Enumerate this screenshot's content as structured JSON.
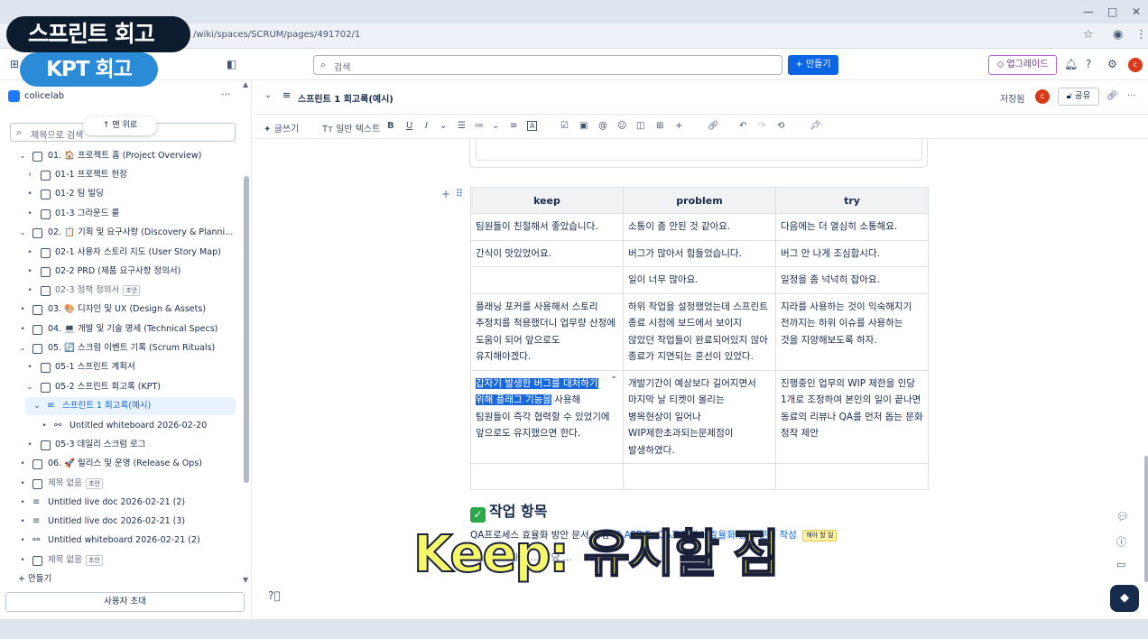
{
  "browser": {
    "url": "/wiki/spaces/SCRUM/pages/491702/1"
  },
  "overlays": {
    "title1": "스프린트 회고",
    "title2": "KPT 회고",
    "caption": "Keep: 유지할 점"
  },
  "topbar": {
    "search_placeholder": "검색",
    "create_label": "+ 만들기",
    "upgrade_label": "업그레이드",
    "avatar_letter": "c"
  },
  "sidebar": {
    "space_name": "colicelab",
    "search_placeholder": "제목으로 검색",
    "scroll_top_label": "↑ 맨 위로",
    "items": [
      {
        "label": "01. 🏠 프로젝트 홈 (Project Overview)"
      },
      {
        "label": "01-1 프로젝트 헌장"
      },
      {
        "label": "01-2 팀 빌딩"
      },
      {
        "label": "01-3 그라운드 룰"
      },
      {
        "label": "02. 📋 기획 및 요구사항 (Discovery & Planni..."
      },
      {
        "label": "02-1 사용자 스토리 지도 (User Story Map)"
      },
      {
        "label": "02-2 PRD (제품 요구사항 정의서)"
      },
      {
        "label": "02-3 정책 정의서",
        "badge": "초안"
      },
      {
        "label": "03. 🎨 디자인 및 UX (Design & Assets)"
      },
      {
        "label": "04. 💻 개발 및 기술 명세 (Technical Specs)"
      },
      {
        "label": "05. 🔄 스크럼 이벤트 기록 (Scrum Rituals)"
      },
      {
        "label": "05-1 스프린트 계획서"
      },
      {
        "label": "05-2 스프린트 회고록 (KPT)"
      },
      {
        "label": "스프린트 1 회고록(예시)"
      },
      {
        "label": "Untitled whiteboard 2026-02-20"
      },
      {
        "label": "05-3 데일리 스크럼 로그"
      },
      {
        "label": "06. 🚀 릴리스 및 운영 (Release & Ops)"
      },
      {
        "label": "제목 없음",
        "badge": "초안"
      },
      {
        "label": "Untitled live doc 2026-02-21 (2)"
      },
      {
        "label": "Untitled live doc 2026-02-21 (3)"
      },
      {
        "label": "Untitled whiteboard 2026-02-21 (2)"
      },
      {
        "label": "제목 없음",
        "badge": "초안"
      },
      {
        "label": "+ 만들기"
      }
    ],
    "invite_label": "사용자 초대"
  },
  "page": {
    "title": "스프린트 1 회고록(예시)",
    "saved_label": "저장됨",
    "share_label": "공유"
  },
  "toolbar": {
    "writing_label": "글쓰기",
    "text_style_label": "일반 텍스트"
  },
  "table": {
    "headers": [
      "keep",
      "problem",
      "try"
    ],
    "rows": [
      [
        "팀원들이 친절해서 좋았습니다.",
        "소통이 좀 안된 것 같아요.",
        "다음에는 더 열심히 소통해요."
      ],
      [
        "간식이 맛있었어요.",
        "버그가 많아서 힘들었습니다.",
        "버그 안 나게 조심합시다."
      ],
      [
        "",
        "일이 너무 많아요.",
        "일정을 좀 넉넉히 잡아요."
      ],
      [
        "플래닝 포커를 사용해서 스토리 추정치를 적용했더니 업무량 산정에 도움이 되어 앞으로도 유지해야겠다.",
        "하위 작업을 설정했었는데 스프린트 종료 시점에 보드에서 보이지 않았던 작업들이 완료되어있지 않아 종료가 지연되는 혼선이 있었다.",
        "지라를 사용하는 것이 익숙해지기 전까지는 하위 이슈를 사용하는 것을 지양해보도록 하자."
      ],
      [
        "",
        "개발기간이 예상보다 길어지면서 마지막 날 티켓이 몰리는 병목현상이 일어나 WIP제한초과되는문제점이 발생하였다.",
        "진행중인 업무의 WIP 제한을 인당 1개로 조정하여 본인의 일이 끝나면 동료의 리뷰나 QA를 먼저 돕는 문화 정착 제안"
      ],
      [
        "",
        "",
        ""
      ]
    ],
    "keep_hl": "갑자기 발생한 버그를 대처하기 위해 플래그 기능을",
    "keep_rest": " 사용해 팀원들이 즉각 협력할 수 있었기에 앞으로도 유지했으면 한다."
  },
  "section": {
    "heading": "작업 항목",
    "task_prefix": "QA프로세스 효율화 방안 문서 작성",
    "task_link": "APP-5: QA프로세스 효율화 방안 문서 작성",
    "task_badge": "해야 할 일",
    "task2": "하고 ... 할당 ..."
  }
}
